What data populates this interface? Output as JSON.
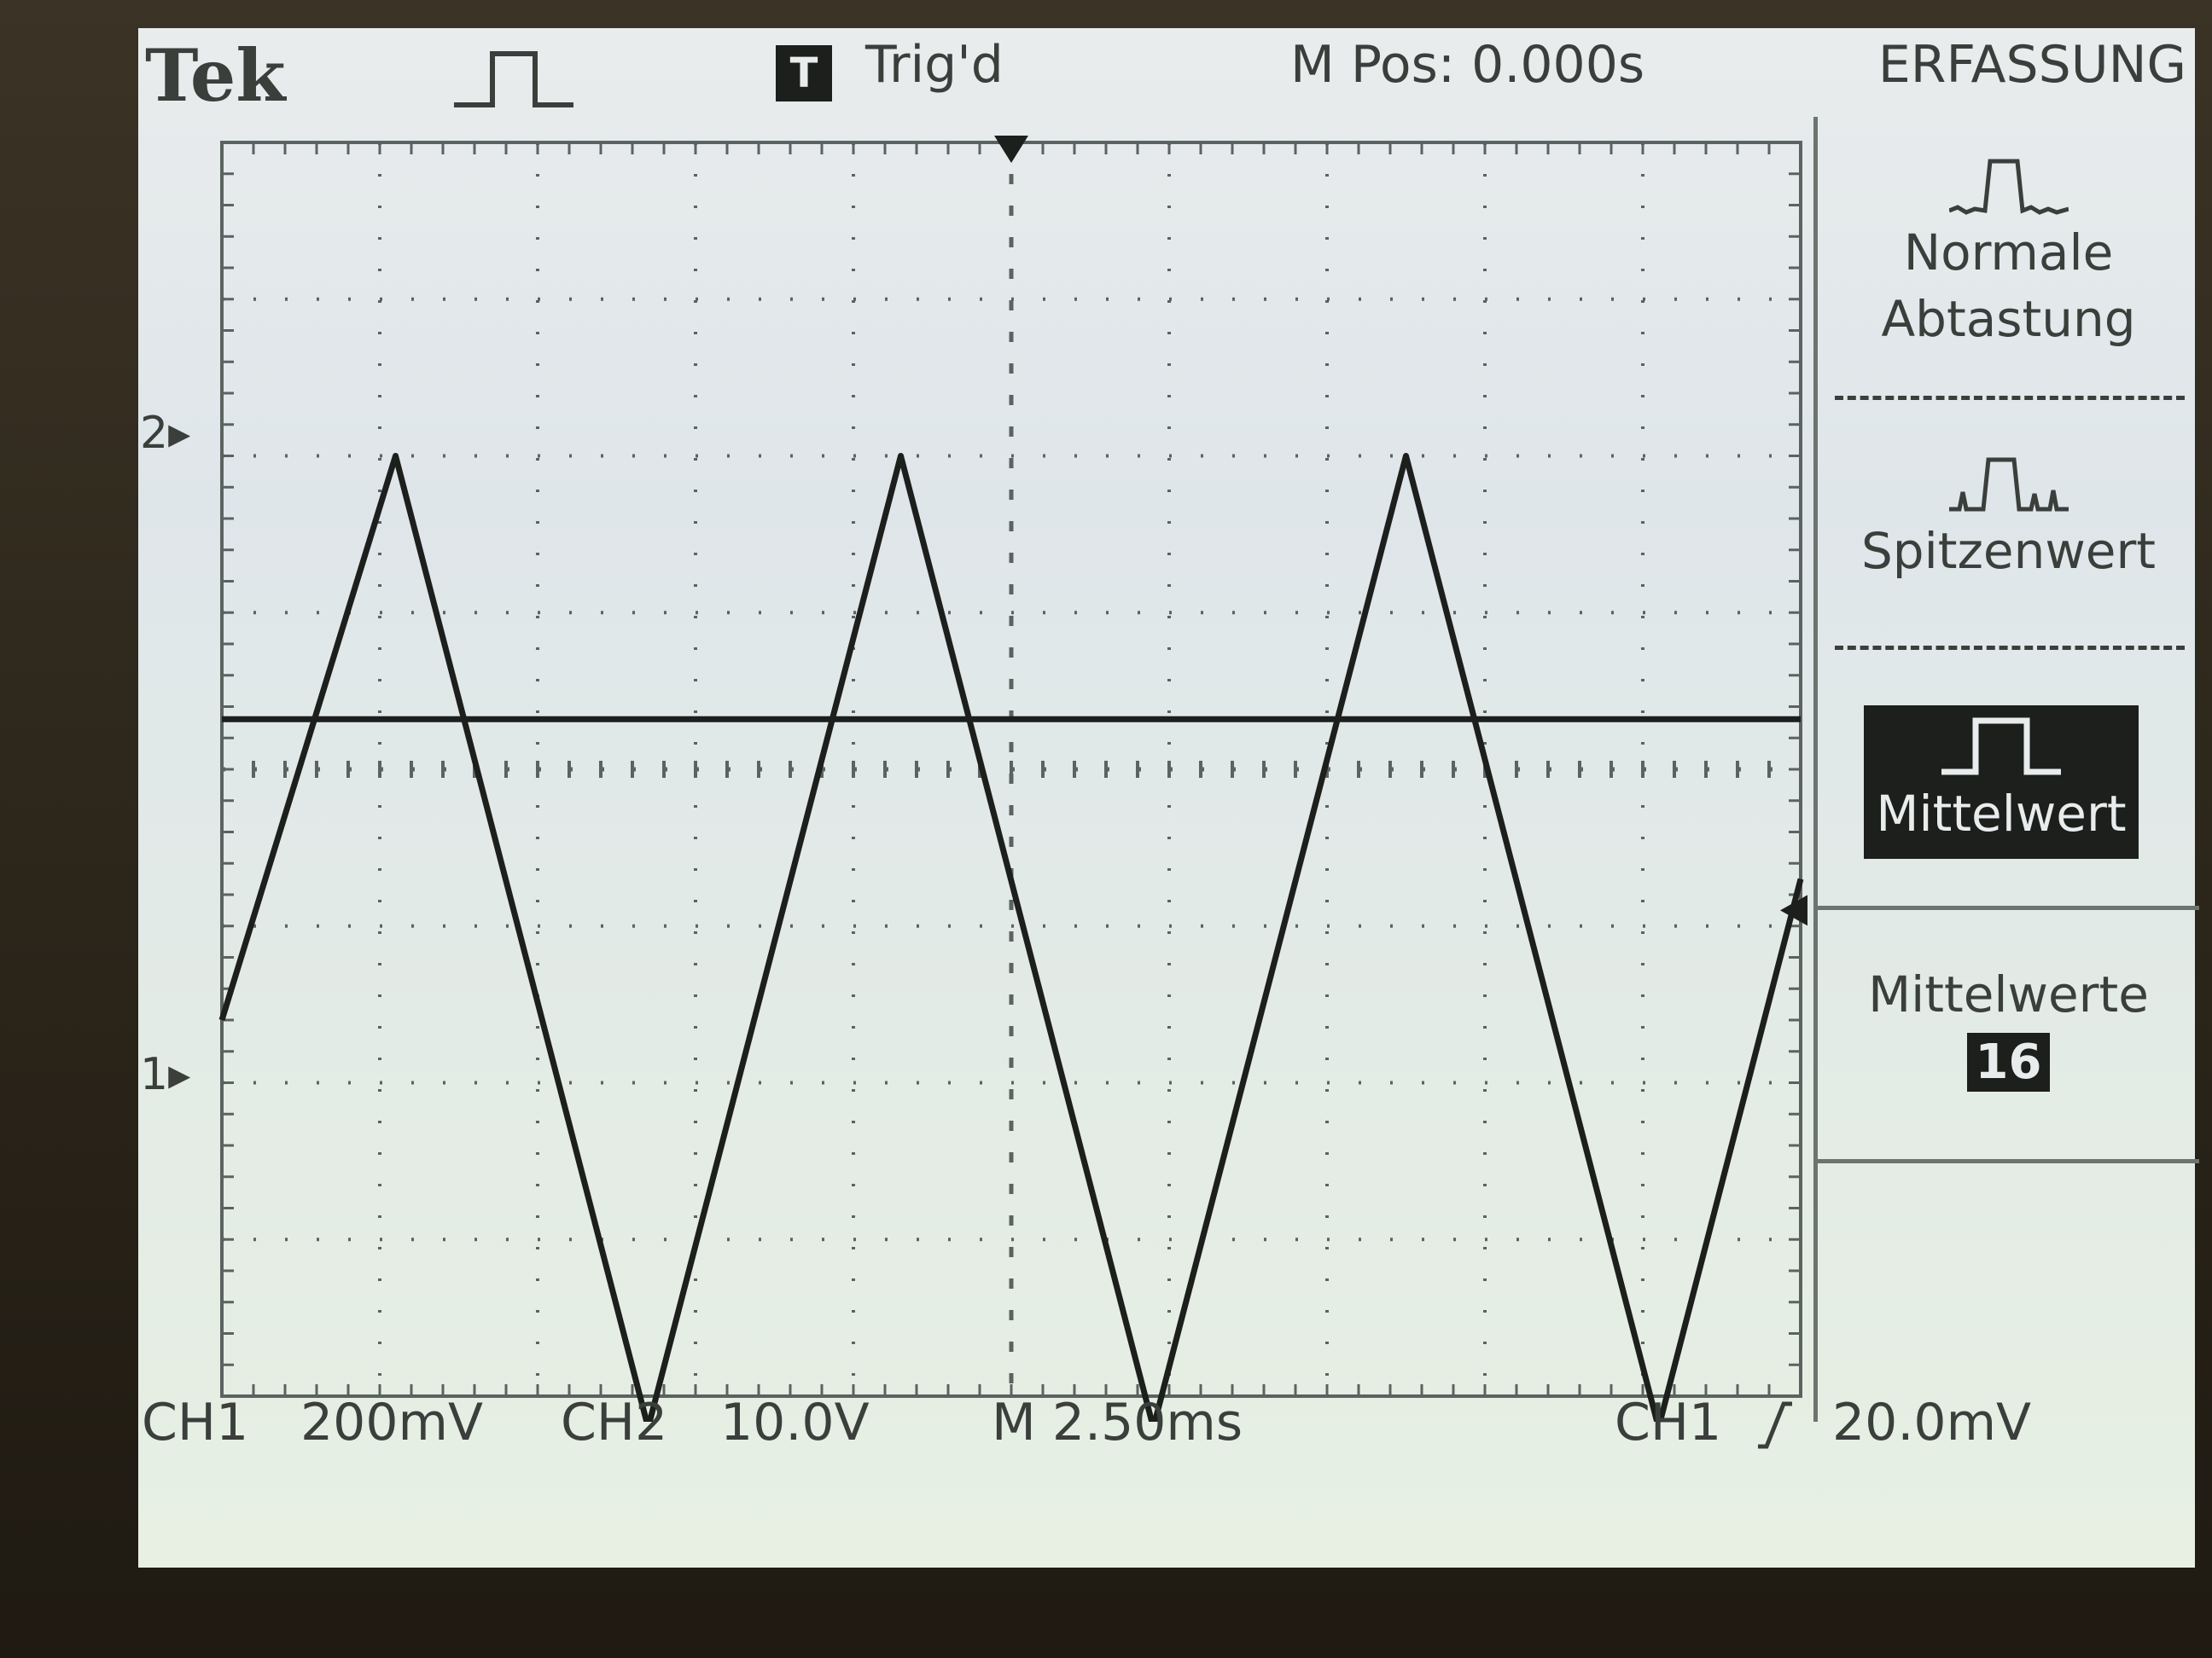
{
  "header": {
    "brand": "Tek",
    "acquire_icon": "square-pulse-icon",
    "trigger_badge": "T",
    "trigger_status": "Trig'd",
    "horizontal_position": "M Pos: 0.000s",
    "menu_title": "ERFASSUNG"
  },
  "channel_markers": {
    "ch2": "2",
    "ch1": "1"
  },
  "footer": {
    "ch1_label": "CH1",
    "ch1_scale": "200mV",
    "ch2_label": "CH2",
    "ch2_scale": "10.0V",
    "timebase": "M 2.50ms",
    "trigger_source": "CH1",
    "trigger_slope_icon": "rising-edge-icon",
    "trigger_level": "20.0mV"
  },
  "menu": {
    "items": [
      {
        "label": "Normale Abtastung",
        "icon": "sample-pulse-icon",
        "selected": false
      },
      {
        "label": "Spitzenwert",
        "icon": "peak-detect-icon",
        "selected": false
      },
      {
        "label": "Mittelwert",
        "icon": "average-pulse-icon",
        "selected": true
      }
    ],
    "averages_label": "Mittelwerte",
    "averages_value": "16"
  },
  "colors": {
    "trace": "#1c1f1c",
    "screen": "#e3ebe6",
    "graticule": "#5a6360"
  },
  "chart_data": {
    "type": "line",
    "divisions": {
      "x": 10,
      "y": 8
    },
    "series": [
      {
        "name": "CH1",
        "x": [
          -12.5,
          -9.75,
          -5.75,
          -1.75,
          2.25,
          6.25,
          10.25,
          12.5
        ],
        "y": [
          -0.12,
          0.6,
          -0.64,
          0.6,
          -0.64,
          0.6,
          -0.64,
          0.06
        ]
      },
      {
        "name": "CH2",
        "x": [
          -12.5,
          12.5
        ],
        "y": [
          1.6,
          1.6
        ]
      }
    ],
    "xlim": [
      -12.5,
      12.5
    ],
    "x_units": "ms"
  }
}
